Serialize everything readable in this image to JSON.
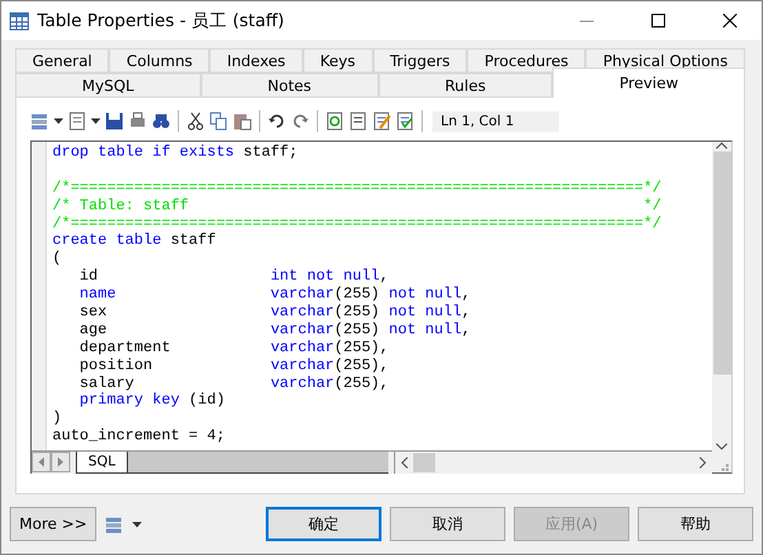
{
  "window": {
    "title": "Table Properties - 员工 (staff)"
  },
  "tab_rows": [
    [
      {
        "label": "General",
        "selected": false
      },
      {
        "label": "Columns",
        "selected": false
      },
      {
        "label": "Indexes",
        "selected": false
      },
      {
        "label": "Keys",
        "selected": false
      },
      {
        "label": "Triggers",
        "selected": false
      },
      {
        "label": "Procedures",
        "selected": false
      },
      {
        "label": "Physical Options",
        "selected": false
      }
    ],
    [
      {
        "label": "MySQL",
        "selected": false
      },
      {
        "label": "Notes",
        "selected": false
      },
      {
        "label": "Rules",
        "selected": false
      },
      {
        "label": "Preview",
        "selected": true
      }
    ]
  ],
  "toolbar": {
    "position": "Ln 1, Col 1"
  },
  "code_blocks": [
    {
      "lines": [
        {
          "segments": [
            {
              "kind": "keyword",
              "text": "drop table if exists"
            },
            {
              "kind": "plain",
              "text": " staff;"
            }
          ]
        }
      ]
    },
    {
      "lines": [
        {
          "segments": [
            {
              "kind": "comment",
              "text": "/*===============================================================*/"
            }
          ]
        },
        {
          "segments": [
            {
              "kind": "comment",
              "text": "/* Table: staff                                                  */"
            }
          ]
        },
        {
          "segments": [
            {
              "kind": "comment",
              "text": "/*===============================================================*/"
            }
          ]
        },
        {
          "segments": [
            {
              "kind": "keyword",
              "text": "create table"
            },
            {
              "kind": "plain",
              "text": " staff"
            }
          ]
        },
        {
          "segments": [
            {
              "kind": "plain",
              "text": "("
            }
          ]
        },
        {
          "segments": [
            {
              "kind": "plain",
              "text": "   id                   "
            },
            {
              "kind": "keyword",
              "text": "int not null"
            },
            {
              "kind": "plain",
              "text": ","
            }
          ]
        },
        {
          "segments": [
            {
              "kind": "keyword",
              "text": "   name"
            },
            {
              "kind": "keyword",
              "text": "                 varchar"
            },
            {
              "kind": "plain",
              "text": "(255) "
            },
            {
              "kind": "keyword",
              "text": "not null"
            },
            {
              "kind": "plain",
              "text": ","
            }
          ]
        },
        {
          "segments": [
            {
              "kind": "plain",
              "text": "   sex                  "
            },
            {
              "kind": "keyword",
              "text": "varchar"
            },
            {
              "kind": "plain",
              "text": "(255) "
            },
            {
              "kind": "keyword",
              "text": "not null"
            },
            {
              "kind": "plain",
              "text": ","
            }
          ]
        },
        {
          "segments": [
            {
              "kind": "plain",
              "text": "   age                  "
            },
            {
              "kind": "keyword",
              "text": "varchar"
            },
            {
              "kind": "plain",
              "text": "(255) "
            },
            {
              "kind": "keyword",
              "text": "not null"
            },
            {
              "kind": "plain",
              "text": ","
            }
          ]
        },
        {
          "segments": [
            {
              "kind": "plain",
              "text": "   department           "
            },
            {
              "kind": "keyword",
              "text": "varchar"
            },
            {
              "kind": "plain",
              "text": "(255),"
            }
          ]
        },
        {
          "segments": [
            {
              "kind": "plain",
              "text": "   position             "
            },
            {
              "kind": "keyword",
              "text": "varchar"
            },
            {
              "kind": "plain",
              "text": "(255),"
            }
          ]
        },
        {
          "segments": [
            {
              "kind": "plain",
              "text": "   salary               "
            },
            {
              "kind": "keyword",
              "text": "varchar"
            },
            {
              "kind": "plain",
              "text": "(255),"
            }
          ]
        },
        {
          "segments": [
            {
              "kind": "keyword",
              "text": "   primary key"
            },
            {
              "kind": "plain",
              "text": " (id)"
            }
          ]
        },
        {
          "segments": [
            {
              "kind": "plain",
              "text": ")"
            }
          ]
        },
        {
          "segments": [
            {
              "kind": "plain",
              "text": "auto_increment = 4;"
            }
          ]
        }
      ]
    }
  ],
  "editor_tabs": [
    {
      "label": "SQL",
      "selected": true
    }
  ],
  "buttons": [
    {
      "label": "确定",
      "default": true,
      "disabled": false
    },
    {
      "label": "取消",
      "default": false,
      "disabled": false
    },
    {
      "label": "应用(A)",
      "default": false,
      "disabled": true
    },
    {
      "label": "帮助",
      "default": false,
      "disabled": false
    }
  ],
  "more_button": {
    "label": "More >>"
  }
}
